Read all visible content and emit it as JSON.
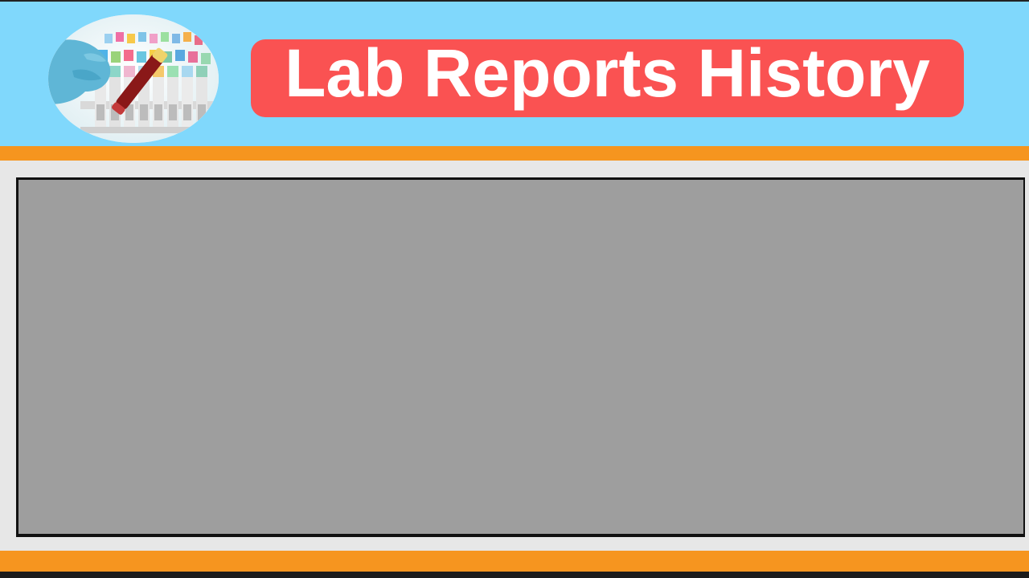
{
  "header": {
    "title": "Lab Reports History",
    "logo_icon": "test-tubes-icon"
  },
  "report_panel": {
    "contents": []
  },
  "colors": {
    "header_background": "#80d8fc",
    "title_background": "#fa5252",
    "title_text": "#ffffff",
    "accent_stripe": "#f6951f",
    "content_background": "#e7e7e7",
    "panel_background": "#9e9e9e",
    "panel_border": "#111111"
  }
}
